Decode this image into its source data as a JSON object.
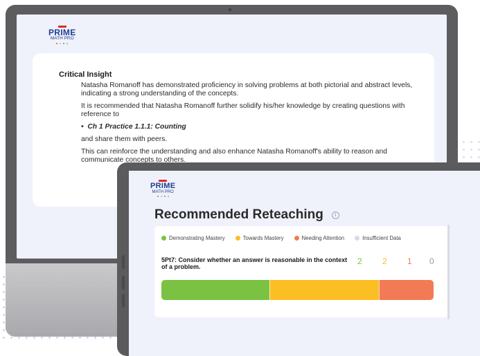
{
  "brand": {
    "name": "PRIME",
    "subtitle": "MATH PRO",
    "dot_colors": [
      "#e5533d",
      "#f5b82e",
      "#4a8fe0",
      "#8dc63f"
    ]
  },
  "insight": {
    "title": "Critical Insight",
    "paragraph1": "Natasha Romanoff has demonstrated proficiency in solving problems at both pictorial and abstract levels, indicating a strong understanding of the concepts.",
    "paragraph2": "It is recommended that Natasha Romanoff further solidify his/her knowledge by creating questions with reference to",
    "bullet": "Ch 1 Practice 1.1.1: Counting",
    "paragraph3": "and share them with peers.",
    "paragraph4": "This can reinforce the understanding and also enhance Natasha Romanoff's ability to reason and communicate concepts to others."
  },
  "reteaching": {
    "title": "Recommended Reteaching",
    "legend": [
      {
        "label": "Demonstrating Mastery",
        "color": "#7cc242"
      },
      {
        "label": "Towards Mastery",
        "color": "#fbbf24"
      },
      {
        "label": "Needing Attention",
        "color": "#f27b55"
      },
      {
        "label": "Insufficient Data",
        "color": "#d6d9ec"
      }
    ],
    "standard": {
      "label": "5Pt7: Consider whether an answer is reasonable in the context of a problem.",
      "counts": [
        {
          "value": "2",
          "color": "#7cc242"
        },
        {
          "value": "2",
          "color": "#fbbf24"
        },
        {
          "value": "1",
          "color": "#f27b55"
        },
        {
          "value": "0",
          "color": "#9a9a9a"
        }
      ],
      "bar_fractions": [
        0.4,
        0.4,
        0.2,
        0
      ]
    }
  }
}
